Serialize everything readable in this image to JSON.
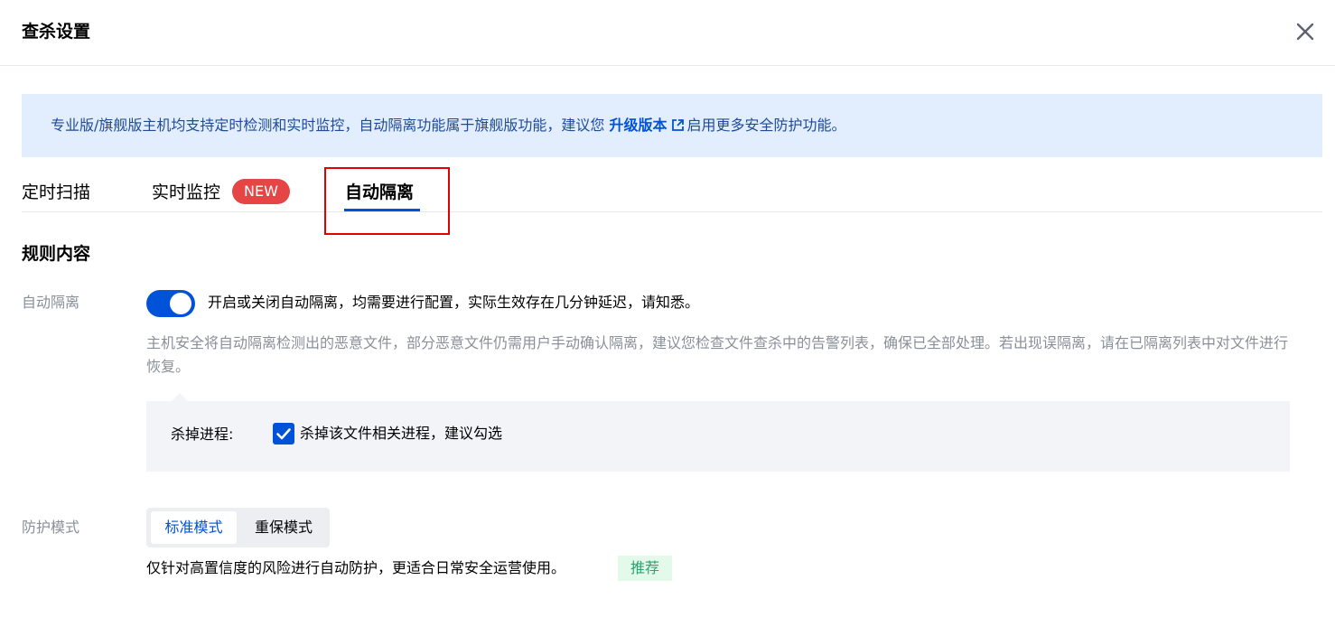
{
  "dialog": {
    "title": "查杀设置"
  },
  "notice": {
    "text_before": "专业版/旗舰版主机均支持定时检测和实时监控，自动隔离功能属于旗舰版功能，建议您",
    "link": "升级版本",
    "text_after": "启用更多安全防护功能。"
  },
  "tabs": [
    {
      "label": "定时扫描"
    },
    {
      "label": "实时监控",
      "badge": "NEW"
    },
    {
      "label": "自动隔离",
      "active": true
    }
  ],
  "section": {
    "title": "规则内容"
  },
  "auto_isolate": {
    "label": "自动隔离",
    "enabled": true,
    "toggle_text": "开启或关闭自动隔离，均需要进行配置，实际生效存在几分钟延迟，请知悉。",
    "description": "主机安全将自动隔离检测出的恶意文件，部分恶意文件仍需用户手动确认隔离，建议您检查文件查杀中的告警列表，确保已全部处理。若出现误隔离，请在已隔离列表中对文件进行恢复。",
    "kill_process": {
      "label": "杀掉进程:",
      "checked": true,
      "checkbox_text": "杀掉该文件相关进程，建议勾选"
    }
  },
  "protection_mode": {
    "label": "防护模式",
    "options": [
      "标准模式",
      "重保模式"
    ],
    "selected": "标准模式",
    "description": "仅针对高置信度的风险进行自动防护，更适合日常安全运营使用。",
    "tag": "推荐"
  },
  "colors": {
    "primary": "#0052d9",
    "badge_red": "#e54545",
    "notice_bg": "#e2eefd",
    "highlight_red": "#e00000",
    "recommend_green": "#2ba471"
  },
  "icons": {
    "close": "close-icon",
    "external_link": "external-link-icon",
    "check": "check-icon"
  }
}
